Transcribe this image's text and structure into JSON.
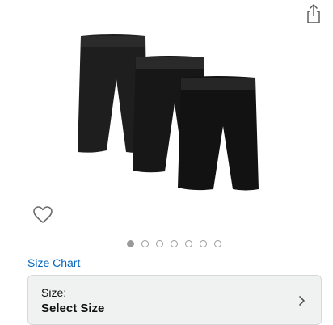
{
  "header": {
    "share_icon": "share-icon"
  },
  "product": {
    "image_icon": "compression-shorts-3-pack",
    "wishlist_icon": "heart-outline-icon"
  },
  "carousel": {
    "total": 7,
    "active": 1
  },
  "size_chart": {
    "label": "Size Chart"
  },
  "size_selector": {
    "label": "Size:",
    "value": "Select Size",
    "chevron_icon": "chevron-right-icon"
  },
  "colors": {
    "link": "#0066c0",
    "selector_bg": "#f0f2f2",
    "selector_border": "#d5d9d9",
    "text": "#0f1111"
  }
}
